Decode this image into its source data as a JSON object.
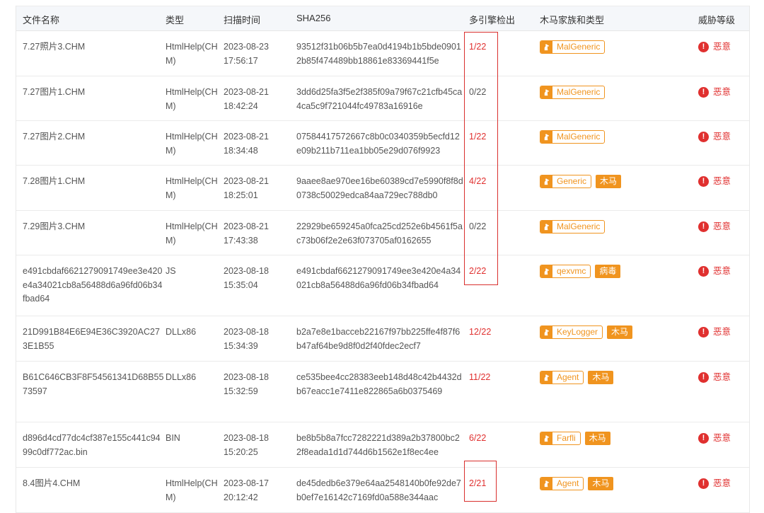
{
  "headers": {
    "name": "文件名称",
    "type": "类型",
    "time": "扫描时间",
    "sha": "SHA256",
    "detect": "多引擎检出",
    "family": "木马家族和类型",
    "threat": "威胁等级"
  },
  "rows": [
    {
      "name": "7.27照片3.CHM",
      "type": "HtmlHelp(CHM)",
      "date": "2023-08-23",
      "clock": "17:56:17",
      "sha": "93512f31b06b5b7ea0d4194b1b5bde09012b85f474489bb18861e83369441f5e",
      "detect": "1/22",
      "detect_status": "positive",
      "family": "MalGeneric",
      "category": "",
      "threat": "恶意"
    },
    {
      "name": "7.27图片1.CHM",
      "type": "HtmlHelp(CHM)",
      "date": "2023-08-21",
      "clock": "18:42:24",
      "sha": "3dd6d25fa3f5e2f385f09a79f67c21cfb45ca4ca5c9f721044fc49783a16916e",
      "detect": "0/22",
      "detect_status": "clean",
      "family": "MalGeneric",
      "category": "",
      "threat": "恶意"
    },
    {
      "name": "7.27图片2.CHM",
      "type": "HtmlHelp(CHM)",
      "date": "2023-08-21",
      "clock": "18:34:48",
      "sha": "07584417572667c8b0c0340359b5ecfd12e09b211b711ea1bb05e29d076f9923",
      "detect": "1/22",
      "detect_status": "positive",
      "family": "MalGeneric",
      "category": "",
      "threat": "恶意"
    },
    {
      "name": "7.28图片1.CHM",
      "type": "HtmlHelp(CHM)",
      "date": "2023-08-21",
      "clock": "18:25:01",
      "sha": "9aaee8ae970ee16be60389cd7e5990f8f8d0738c50029edca84aa729ec788db0",
      "detect": "4/22",
      "detect_status": "positive",
      "family": "Generic",
      "category": "木马",
      "threat": "恶意"
    },
    {
      "name": "7.29图片3.CHM",
      "type": "HtmlHelp(CHM)",
      "date": "2023-08-21",
      "clock": "17:43:38",
      "sha": "22929be659245a0fca25cd252e6b4561f5ac73b06f2e2e63f073705af0162655",
      "detect": "0/22",
      "detect_status": "clean",
      "family": "MalGeneric",
      "category": "",
      "threat": "恶意"
    },
    {
      "name": "e491cbdaf6621279091749ee3e420e4a34021cb8a56488d6a96fd06b34fbad64",
      "type": "JS",
      "date": "2023-08-18",
      "clock": "15:35:04",
      "sha": "e491cbdaf6621279091749ee3e420e4a34021cb8a56488d6a96fd06b34fbad64",
      "detect": "2/22",
      "detect_status": "positive",
      "family": "qexvmc",
      "category": "病毒",
      "threat": "恶意"
    },
    {
      "name": "21D991B84E6E94E36C3920AC273E1B55",
      "type": "DLLx86",
      "date": "2023-08-18",
      "clock": "15:34:39",
      "sha": "b2a7e8e1bacceb22167f97bb225ffe4f87f6b47af64be9d8f0d2f40fdec2ecf7",
      "detect": "12/22",
      "detect_status": "positive",
      "family": "KeyLogger",
      "category": "木马",
      "threat": "恶意"
    },
    {
      "name": "B61C646CB3F8F54561341D68B5573597",
      "type": "DLLx86",
      "date": "2023-08-18",
      "clock": "15:32:59",
      "sha": "ce535bee4cc28383eeb148d48c42b4432db67eacc1e7411e822865a6b0375469",
      "detect": "11/22",
      "detect_status": "positive",
      "family": "Agent",
      "category": "木马",
      "threat": "恶意"
    },
    {
      "name": "d896d4cd77dc4cf387e155c441c9499c0df772ac.bin",
      "type": "BIN",
      "date": "2023-08-18",
      "clock": "15:20:25",
      "sha": "be8b5b8a7fcc7282221d389a2b37800bc22f8eada1d1d744d6b1562e1f8ec4ee",
      "detect": "6/22",
      "detect_status": "positive",
      "family": "Farfli",
      "category": "木马",
      "threat": "恶意"
    },
    {
      "name": "8.4图片4.CHM",
      "type": "HtmlHelp(CHM)",
      "date": "2023-08-17",
      "clock": "20:12:42",
      "sha": "de45dedb6e379e64aa2548140b0fe92de7b0ef7e16142c7169fd0a588e344aac",
      "detect": "2/21",
      "detect_status": "positive",
      "family": "Agent",
      "category": "木马",
      "threat": "恶意"
    }
  ],
  "colors": {
    "positive": "#e0302f",
    "clean": "#555555",
    "badge": "#f0941f",
    "highlight": "#d9302e"
  },
  "icons": {
    "family_badge": "horse-icon",
    "threat": "exclamation-circle-icon"
  }
}
